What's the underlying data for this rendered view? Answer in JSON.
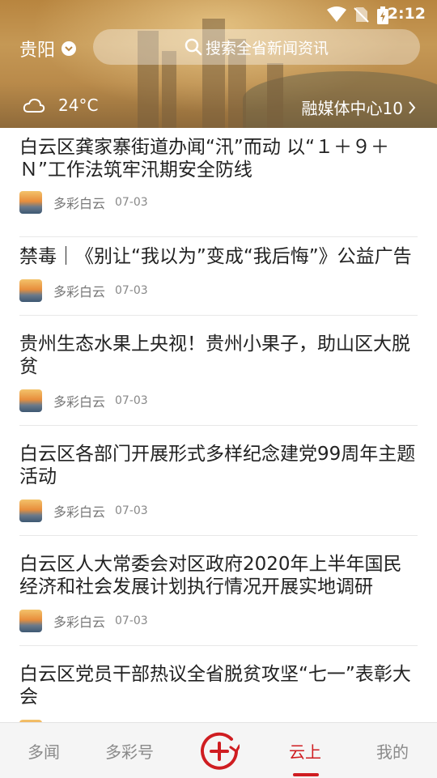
{
  "status_bar": {
    "time": "2:12"
  },
  "header": {
    "city": "贵阳",
    "search_placeholder": "搜索全省新闻资讯",
    "temperature": "24°C",
    "media_center": "融媒体中心10"
  },
  "news": [
    {
      "title": "白云区龚家寨街道办闻“汛”而动 以“１＋９＋Ｎ”工作法筑牢汛期安全防线",
      "source": "多彩白云",
      "date": "07-03"
    },
    {
      "title": "禁毒｜《别让“我以为”变成“我后悔”》公益广告",
      "source": "多彩白云",
      "date": "07-03"
    },
    {
      "title": "贵州生态水果上央视！贵州小果子，助山区大脱贫",
      "source": "多彩白云",
      "date": "07-03"
    },
    {
      "title": "白云区各部门开展形式多样纪念建党99周年主题活动",
      "source": "多彩白云",
      "date": "07-03"
    },
    {
      "title": "白云区人大常委会对区政府2020年上半年国民经济和社会发展计划执行情况开展实地调研",
      "source": "多彩白云",
      "date": "07-03"
    },
    {
      "title": "白云区党员干部热议全省脱贫攻坚“七一”表彰大会",
      "source": "",
      "date": ""
    }
  ],
  "tabs": [
    {
      "label": "多闻",
      "active": false
    },
    {
      "label": "多彩号",
      "active": false
    },
    {
      "label": "",
      "icon": "plus-circle-icon",
      "active": false
    },
    {
      "label": "云上",
      "active": true
    },
    {
      "label": "我的",
      "active": false
    }
  ],
  "colors": {
    "accent": "#cf1d21"
  }
}
